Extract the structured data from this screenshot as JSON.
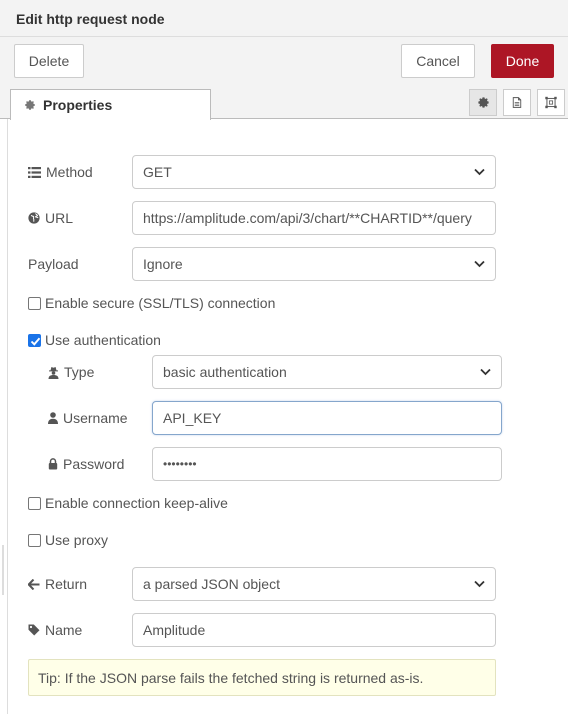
{
  "window": {
    "title": "Edit http request node"
  },
  "toolbar": {
    "delete_label": "Delete",
    "cancel_label": "Cancel",
    "done_label": "Done",
    "done_color": "#ad1625"
  },
  "tabs": {
    "properties_label": "Properties",
    "icons": [
      "gear-icon",
      "description-icon",
      "appearance-icon"
    ]
  },
  "form": {
    "method": {
      "label": "Method",
      "value": "GET"
    },
    "url": {
      "label": "URL",
      "value": "https://amplitude.com/api/3/chart/**CHARTID**/query"
    },
    "payload": {
      "label": "Payload",
      "value": "Ignore"
    },
    "tls": {
      "label": "Enable secure (SSL/TLS) connection",
      "checked": false
    },
    "auth": {
      "label": "Use authentication",
      "checked": true
    },
    "type": {
      "label": "Type",
      "value": "basic authentication"
    },
    "username": {
      "label": "Username",
      "value": "API_KEY"
    },
    "password": {
      "label": "Password",
      "value": "••••••••"
    },
    "keepalive": {
      "label": "Enable connection keep-alive",
      "checked": false
    },
    "proxy": {
      "label": "Use proxy",
      "checked": false
    },
    "return": {
      "label": "Return",
      "value": "a parsed JSON object"
    },
    "name": {
      "label": "Name",
      "value": "Amplitude"
    }
  },
  "tip": "Tip: If the JSON parse fails the fetched string is returned as-is."
}
